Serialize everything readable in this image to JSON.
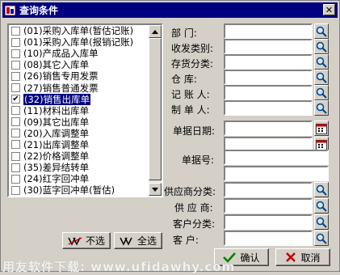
{
  "window": {
    "title": "查询条件",
    "close_glyph": "✕"
  },
  "doc_types": [
    {
      "label": "(01)采购入库单(暂估记账)",
      "checked": false,
      "selected": false
    },
    {
      "label": "(01)采购入库单(报销记账)",
      "checked": false,
      "selected": false
    },
    {
      "label": "(10)产成品入库单",
      "checked": false,
      "selected": false
    },
    {
      "label": "(08)其它入库单",
      "checked": false,
      "selected": false
    },
    {
      "label": "(26)销售专用发票",
      "checked": false,
      "selected": false
    },
    {
      "label": "(27)销售普通发票",
      "checked": false,
      "selected": false
    },
    {
      "label": "(32)销售出库单",
      "checked": true,
      "selected": true
    },
    {
      "label": "(11)材料出库单",
      "checked": false,
      "selected": false
    },
    {
      "label": "(09)其它出库单",
      "checked": false,
      "selected": false
    },
    {
      "label": "(20)入库调整单",
      "checked": false,
      "selected": false
    },
    {
      "label": "(21)出库调整单",
      "checked": false,
      "selected": false
    },
    {
      "label": "(22)价格调整单",
      "checked": false,
      "selected": false
    },
    {
      "label": "(35)差异结转单",
      "checked": false,
      "selected": false
    },
    {
      "label": "(24)红字回冲单",
      "checked": false,
      "selected": false
    },
    {
      "label": "(30)蓝字回冲单(暂估)",
      "checked": false,
      "selected": false
    }
  ],
  "buttons": {
    "deselect_all": "不选",
    "select_all": "全选",
    "confirm": "确认",
    "cancel": "取消"
  },
  "fields": {
    "department": "部    门:",
    "send_receive_category": "收发类别:",
    "inventory_category": "存货分类:",
    "warehouse": "仓    库:",
    "bookkeeper": "记 账 人:",
    "preparer": "制 单 人:",
    "doc_date": "单据日期:",
    "doc_number": "单据号:",
    "supplier_category": "供应商分类:",
    "supplier": "供 应 商:",
    "customer_category": "客户分类:",
    "customer": "客    户:"
  },
  "watermark": "用友软件下载: www.ufidawhy.com",
  "colors": {
    "title_bar": "#000080",
    "dialog_bg": "#d4d0c8",
    "selection": "#000080"
  }
}
